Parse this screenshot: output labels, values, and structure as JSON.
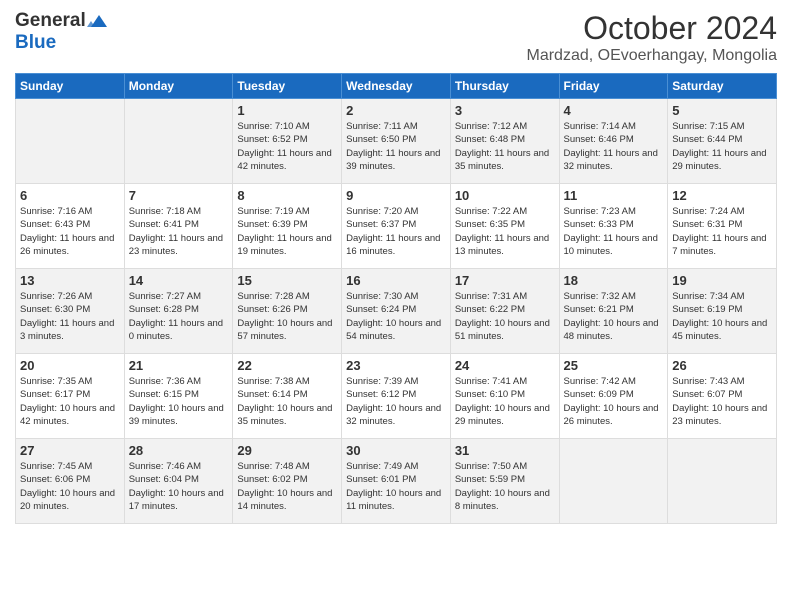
{
  "header": {
    "logo_general": "General",
    "logo_blue": "Blue",
    "month_title": "October 2024",
    "location": "Mardzad, OEvoerhangay, Mongolia"
  },
  "weekdays": [
    "Sunday",
    "Monday",
    "Tuesday",
    "Wednesday",
    "Thursday",
    "Friday",
    "Saturday"
  ],
  "weeks": [
    [
      {
        "day": "",
        "info": ""
      },
      {
        "day": "",
        "info": ""
      },
      {
        "day": "1",
        "info": "Sunrise: 7:10 AM\nSunset: 6:52 PM\nDaylight: 11 hours and 42 minutes."
      },
      {
        "day": "2",
        "info": "Sunrise: 7:11 AM\nSunset: 6:50 PM\nDaylight: 11 hours and 39 minutes."
      },
      {
        "day": "3",
        "info": "Sunrise: 7:12 AM\nSunset: 6:48 PM\nDaylight: 11 hours and 35 minutes."
      },
      {
        "day": "4",
        "info": "Sunrise: 7:14 AM\nSunset: 6:46 PM\nDaylight: 11 hours and 32 minutes."
      },
      {
        "day": "5",
        "info": "Sunrise: 7:15 AM\nSunset: 6:44 PM\nDaylight: 11 hours and 29 minutes."
      }
    ],
    [
      {
        "day": "6",
        "info": "Sunrise: 7:16 AM\nSunset: 6:43 PM\nDaylight: 11 hours and 26 minutes."
      },
      {
        "day": "7",
        "info": "Sunrise: 7:18 AM\nSunset: 6:41 PM\nDaylight: 11 hours and 23 minutes."
      },
      {
        "day": "8",
        "info": "Sunrise: 7:19 AM\nSunset: 6:39 PM\nDaylight: 11 hours and 19 minutes."
      },
      {
        "day": "9",
        "info": "Sunrise: 7:20 AM\nSunset: 6:37 PM\nDaylight: 11 hours and 16 minutes."
      },
      {
        "day": "10",
        "info": "Sunrise: 7:22 AM\nSunset: 6:35 PM\nDaylight: 11 hours and 13 minutes."
      },
      {
        "day": "11",
        "info": "Sunrise: 7:23 AM\nSunset: 6:33 PM\nDaylight: 11 hours and 10 minutes."
      },
      {
        "day": "12",
        "info": "Sunrise: 7:24 AM\nSunset: 6:31 PM\nDaylight: 11 hours and 7 minutes."
      }
    ],
    [
      {
        "day": "13",
        "info": "Sunrise: 7:26 AM\nSunset: 6:30 PM\nDaylight: 11 hours and 3 minutes."
      },
      {
        "day": "14",
        "info": "Sunrise: 7:27 AM\nSunset: 6:28 PM\nDaylight: 11 hours and 0 minutes."
      },
      {
        "day": "15",
        "info": "Sunrise: 7:28 AM\nSunset: 6:26 PM\nDaylight: 10 hours and 57 minutes."
      },
      {
        "day": "16",
        "info": "Sunrise: 7:30 AM\nSunset: 6:24 PM\nDaylight: 10 hours and 54 minutes."
      },
      {
        "day": "17",
        "info": "Sunrise: 7:31 AM\nSunset: 6:22 PM\nDaylight: 10 hours and 51 minutes."
      },
      {
        "day": "18",
        "info": "Sunrise: 7:32 AM\nSunset: 6:21 PM\nDaylight: 10 hours and 48 minutes."
      },
      {
        "day": "19",
        "info": "Sunrise: 7:34 AM\nSunset: 6:19 PM\nDaylight: 10 hours and 45 minutes."
      }
    ],
    [
      {
        "day": "20",
        "info": "Sunrise: 7:35 AM\nSunset: 6:17 PM\nDaylight: 10 hours and 42 minutes."
      },
      {
        "day": "21",
        "info": "Sunrise: 7:36 AM\nSunset: 6:15 PM\nDaylight: 10 hours and 39 minutes."
      },
      {
        "day": "22",
        "info": "Sunrise: 7:38 AM\nSunset: 6:14 PM\nDaylight: 10 hours and 35 minutes."
      },
      {
        "day": "23",
        "info": "Sunrise: 7:39 AM\nSunset: 6:12 PM\nDaylight: 10 hours and 32 minutes."
      },
      {
        "day": "24",
        "info": "Sunrise: 7:41 AM\nSunset: 6:10 PM\nDaylight: 10 hours and 29 minutes."
      },
      {
        "day": "25",
        "info": "Sunrise: 7:42 AM\nSunset: 6:09 PM\nDaylight: 10 hours and 26 minutes."
      },
      {
        "day": "26",
        "info": "Sunrise: 7:43 AM\nSunset: 6:07 PM\nDaylight: 10 hours and 23 minutes."
      }
    ],
    [
      {
        "day": "27",
        "info": "Sunrise: 7:45 AM\nSunset: 6:06 PM\nDaylight: 10 hours and 20 minutes."
      },
      {
        "day": "28",
        "info": "Sunrise: 7:46 AM\nSunset: 6:04 PM\nDaylight: 10 hours and 17 minutes."
      },
      {
        "day": "29",
        "info": "Sunrise: 7:48 AM\nSunset: 6:02 PM\nDaylight: 10 hours and 14 minutes."
      },
      {
        "day": "30",
        "info": "Sunrise: 7:49 AM\nSunset: 6:01 PM\nDaylight: 10 hours and 11 minutes."
      },
      {
        "day": "31",
        "info": "Sunrise: 7:50 AM\nSunset: 5:59 PM\nDaylight: 10 hours and 8 minutes."
      },
      {
        "day": "",
        "info": ""
      },
      {
        "day": "",
        "info": ""
      }
    ]
  ]
}
